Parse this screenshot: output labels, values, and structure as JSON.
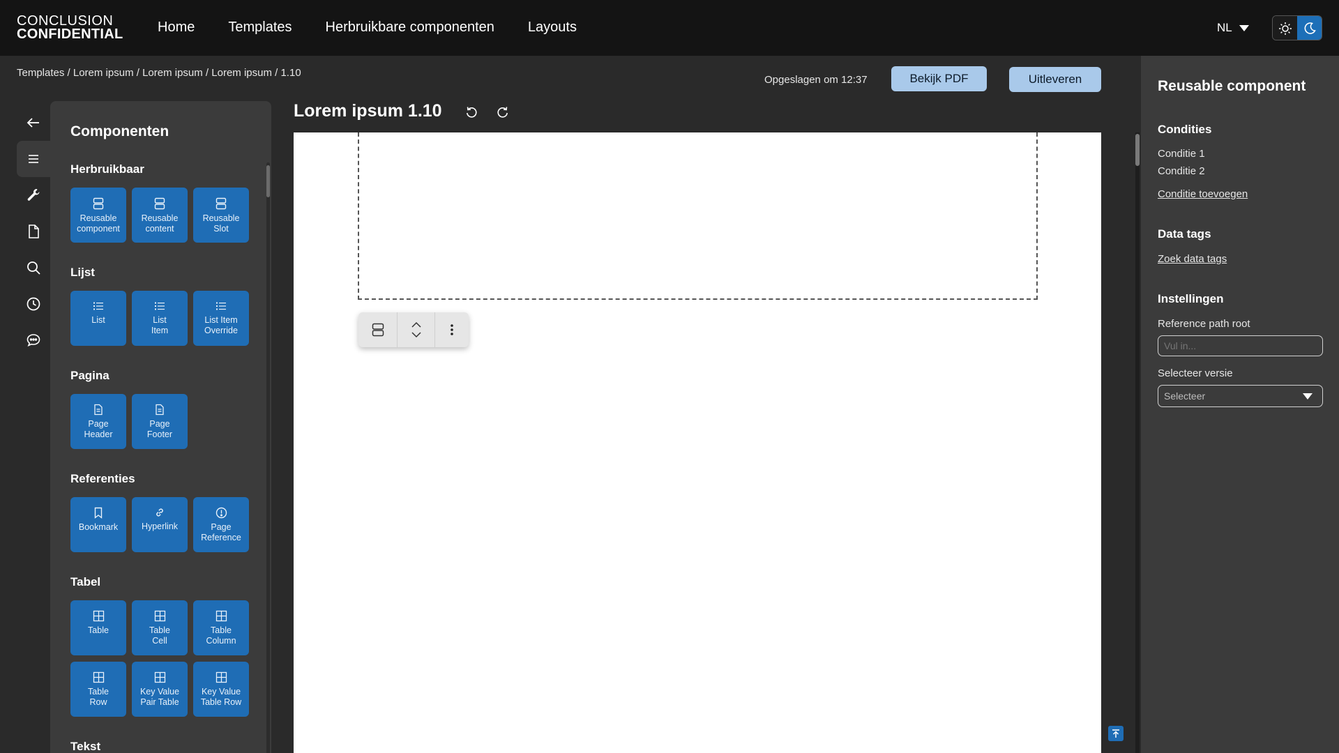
{
  "brand": {
    "line1": "CONCLUSION",
    "line2": "CONFIDENTIAL"
  },
  "nav": [
    "Home",
    "Templates",
    "Herbruikbare componenten",
    "Layouts"
  ],
  "language": "NL",
  "breadcrumb": "Templates / Lorem ipsum / Lorem ipsum / Lorem ipsum / 1.10",
  "saved_text": "Opgeslagen om 12:37",
  "buttons": {
    "view_pdf": "Bekijk PDF",
    "deliver": "Uitleveren"
  },
  "document": {
    "title": "Lorem ipsum 1.10"
  },
  "rail_icons": [
    "back-arrow-icon",
    "menu-icon",
    "wrench-icon",
    "document-icon",
    "search-icon",
    "clock-icon",
    "chat-icon"
  ],
  "components_panel": {
    "title": "Componenten",
    "sections": [
      {
        "title": "Herbruikbaar",
        "items": [
          {
            "label": "Reusable\ncomponent",
            "icon": "rows-icon"
          },
          {
            "label": "Reusable\ncontent",
            "icon": "rows-icon"
          },
          {
            "label": "Reusable\nSlot",
            "icon": "rows-icon"
          }
        ]
      },
      {
        "title": "Lijst",
        "items": [
          {
            "label": "List",
            "icon": "list-icon"
          },
          {
            "label": "List\nItem",
            "icon": "list-icon"
          },
          {
            "label": "List Item\nOverride",
            "icon": "list-icon"
          }
        ]
      },
      {
        "title": "Pagina",
        "items": [
          {
            "label": "Page\nHeader",
            "icon": "page-icon"
          },
          {
            "label": "Page\nFooter",
            "icon": "page-icon"
          }
        ]
      },
      {
        "title": "Referenties",
        "items": [
          {
            "label": "Bookmark",
            "icon": "bookmark-icon"
          },
          {
            "label": "Hyperlink",
            "icon": "link-icon"
          },
          {
            "label": "Page\nReference",
            "icon": "info-icon"
          }
        ]
      },
      {
        "title": "Tabel",
        "items": [
          {
            "label": "Table",
            "icon": "table-icon"
          },
          {
            "label": "Table\nCell",
            "icon": "table-icon"
          },
          {
            "label": "Table\nColumn",
            "icon": "table-icon"
          },
          {
            "label": "Table\nRow",
            "icon": "table-icon"
          },
          {
            "label": "Key Value\nPair Table",
            "icon": "table-icon"
          },
          {
            "label": "Key Value\nTable Row",
            "icon": "table-icon"
          }
        ]
      },
      {
        "title": "Tekst",
        "items": []
      }
    ]
  },
  "right_panel": {
    "title": "Reusable component",
    "conditions_title": "Condities",
    "conditions": [
      "Conditie 1",
      "Conditie 2"
    ],
    "add_condition": "Conditie toevoegen",
    "data_tags_title": "Data tags",
    "search_data_tags": "Zoek data tags",
    "settings_title": "Instellingen",
    "reference_path_label": "Reference path root",
    "reference_path_placeholder": "Vul in...",
    "version_label": "Selecteer versie",
    "version_value": "Selecteer"
  },
  "colors": {
    "accent": "#1f6db5",
    "button_light": "#a9c9ea",
    "panel": "#3b3b3b",
    "topbar": "#141414",
    "background": "#2a2a2a"
  }
}
